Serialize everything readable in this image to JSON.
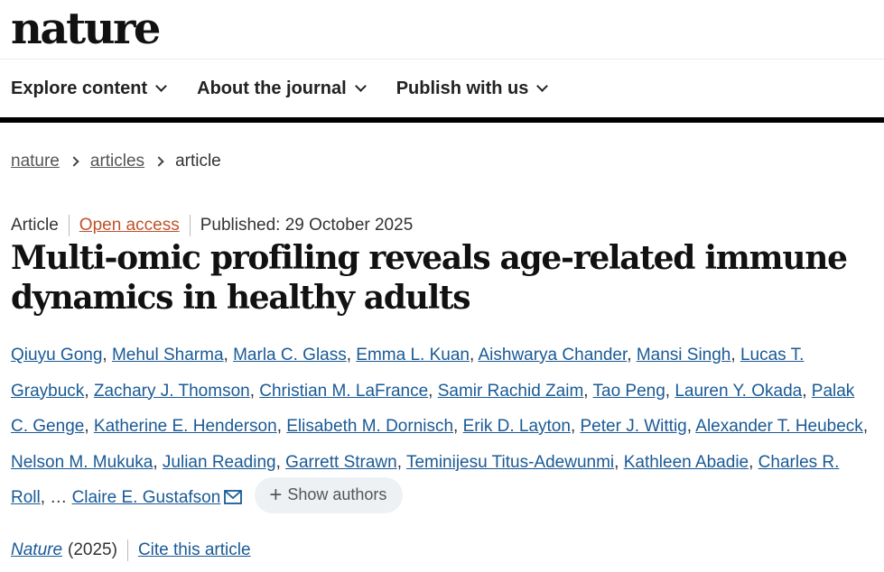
{
  "site": {
    "logo": "nature"
  },
  "nav": [
    {
      "label": "Explore content"
    },
    {
      "label": "About the journal"
    },
    {
      "label": "Publish with us"
    }
  ],
  "breadcrumb": [
    "nature",
    "articles",
    "article"
  ],
  "meta": {
    "type": "Article",
    "access": "Open access",
    "published": "Published: 29 October 2025"
  },
  "title": "Multi-omic profiling reveals age-related immune dynamics in healthy adults",
  "authors": [
    "Qiuyu Gong",
    "Mehul Sharma",
    "Marla C. Glass",
    "Emma L. Kuan",
    "Aishwarya Chander",
    "Mansi Singh",
    "Lucas T. Graybuck",
    "Zachary J. Thomson",
    "Christian M. LaFrance",
    "Samir Rachid Zaim",
    "Tao Peng",
    "Lauren Y. Okada",
    "Palak C. Genge",
    "Katherine E. Henderson",
    "Elisabeth M. Dornisch",
    "Erik D. Layton",
    "Peter J. Wittig",
    "Alexander T. Heubeck",
    "Nelson M. Mukuka",
    "Julian Reading",
    "Garrett Strawn",
    "Teminijesu Titus-Adewunmi",
    "Kathleen Abadie",
    "Charles R. Roll"
  ],
  "ellipsis": "…",
  "last_author": "Claire E. Gustafson",
  "show_authors_label": "Show authors",
  "citation": {
    "journal": "Nature",
    "year": "(2025)",
    "cite_label": "Cite this article"
  },
  "icons": {
    "chevron": "chevron-down-icon",
    "mail": "mail-icon",
    "plus": "plus-icon"
  },
  "colors": {
    "link": "#1a5a96",
    "open_access": "#c0522a",
    "button_bg": "#eef1f4"
  }
}
